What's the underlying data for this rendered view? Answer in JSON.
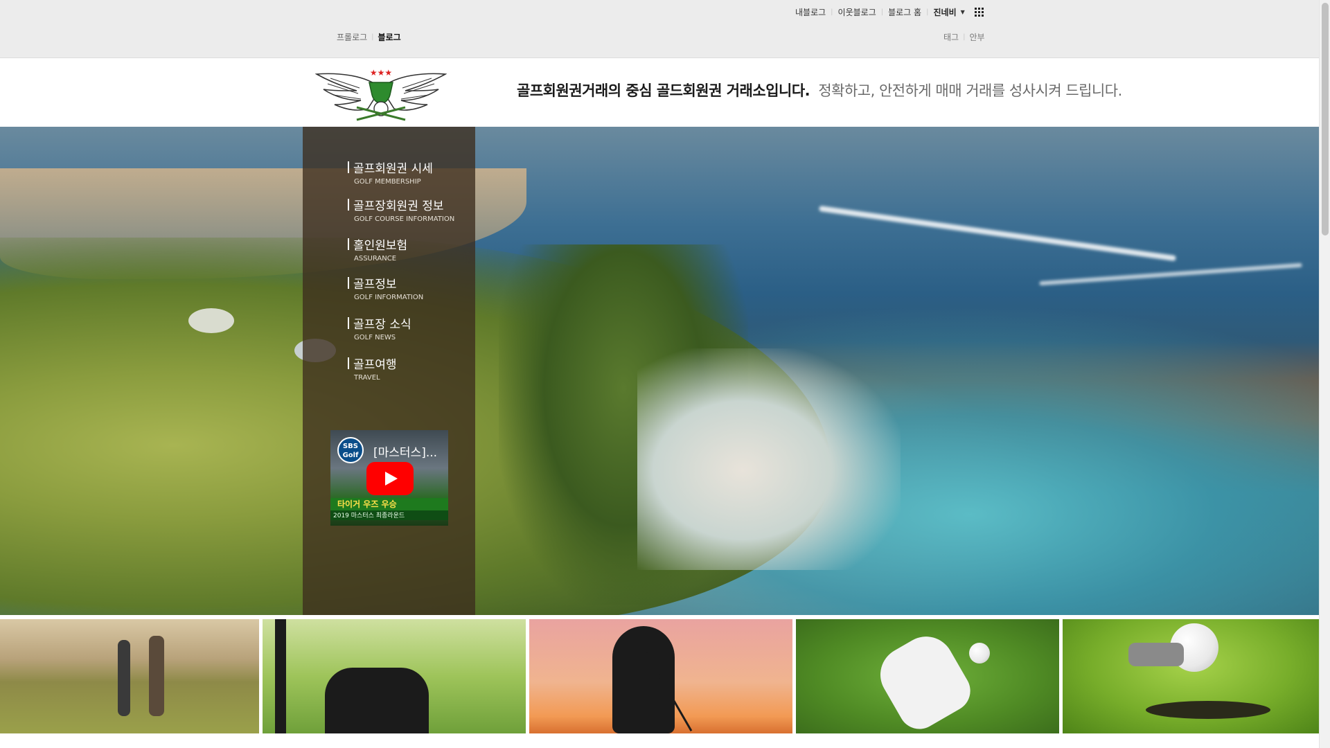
{
  "gnb": {
    "my_blog": "내블로그",
    "neighbor_blog": "이웃블로그",
    "blog_home": "블로그 홈",
    "user_name": "진네비"
  },
  "subnav": {
    "left": [
      "프롤로그",
      "블로그"
    ],
    "right": [
      "태그",
      "안부"
    ]
  },
  "header": {
    "tagline_bold": "골프회원권거래의 중심 골드회원권 거래소입니다.",
    "tagline_light": "정확하고, 안전하게 매매 거래를 성사시켜 드립니다."
  },
  "menu": [
    {
      "ko": "골프회원권 시세",
      "en": "GOLF MEMBERSHIP"
    },
    {
      "ko": "골프장회원권 정보",
      "en": "GOLF COURSE INFORMATION"
    },
    {
      "ko": "홀인원보험",
      "en": "ASSURANCE"
    },
    {
      "ko": "골프정보",
      "en": "GOLF INFORMATION"
    },
    {
      "ko": "골프장 소식",
      "en": "GOLF NEWS"
    },
    {
      "ko": "골프여행",
      "en": "TRAVEL"
    }
  ],
  "video": {
    "channel": "SBS Golf",
    "title": "[마스터스]...",
    "caption1": "타이거 우즈 우승",
    "caption2": "2019 마스터스 최종라운드"
  },
  "icons": [
    "logo-emblem",
    "apps-grid-icon",
    "caret-down-icon",
    "youtube-play-icon"
  ],
  "colors": {
    "topbar": "#ececec",
    "sidebar": "#3c2d1e",
    "accent_red": "#ff0000"
  }
}
